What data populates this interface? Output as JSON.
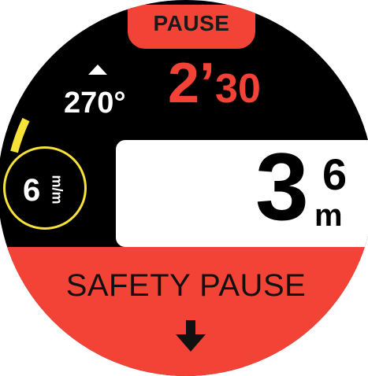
{
  "status": {
    "pause_label": "PAUSE"
  },
  "compass": {
    "heading": "270°",
    "arrow_icon": "heading-up-arrow-icon"
  },
  "timer": {
    "minutes": "2’",
    "seconds": "30",
    "color": "#f34336"
  },
  "depth": {
    "whole": "3",
    "decimal": "6",
    "unit": "m"
  },
  "ascent_rate": {
    "value": "6",
    "unit": "m/m",
    "ring_color": "#f7e23a"
  },
  "alert": {
    "text": "SAFETY PAUSE",
    "icon": "down-arrow-icon",
    "background": "#f34336"
  }
}
